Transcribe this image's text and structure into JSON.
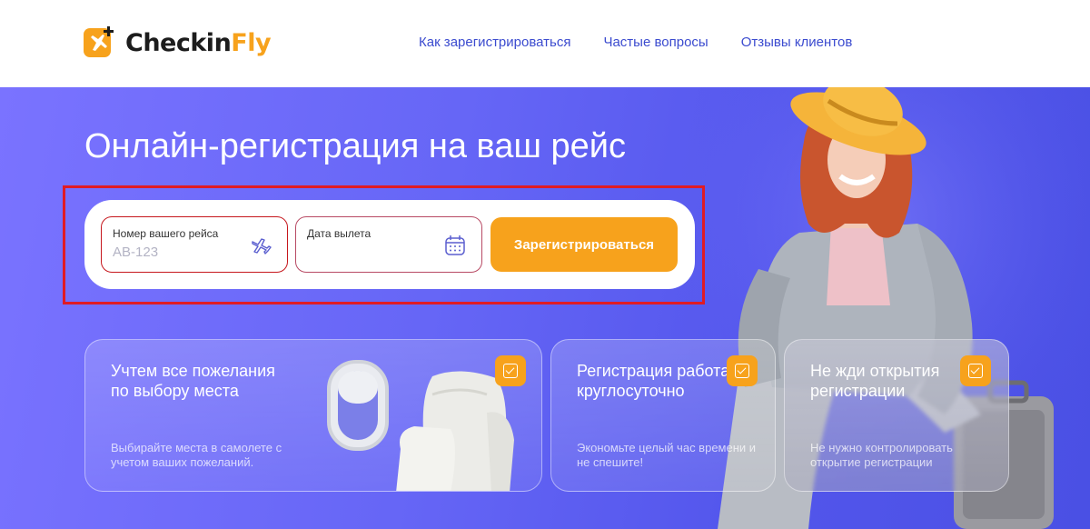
{
  "brand": {
    "name_part1": "Checkin",
    "name_part2": "Fly",
    "accent": "#f7a21c"
  },
  "nav": [
    {
      "label": "Как зарегистрироваться"
    },
    {
      "label": "Частые вопросы"
    },
    {
      "label": "Отзывы клиентов"
    }
  ],
  "hero": {
    "title": "Онлайн-регистрация на ваш рейс"
  },
  "form": {
    "flight_label": "Номер вашего рейса",
    "flight_placeholder": "AB-123",
    "flight_icon": "airplane-icon",
    "date_label": "Дата вылета",
    "date_placeholder": "",
    "date_icon": "calendar-icon",
    "submit_label": "Зарегистрироваться"
  },
  "cards": [
    {
      "title": "Учтем все пожелания по выбору места",
      "desc": "Выбирайте места в самолете с учетом ваших пожеланий."
    },
    {
      "title": "Регистрация работает круглосуточно",
      "desc": "Экономьте целый час времени и не спешите!"
    },
    {
      "title": "Не жди открытия регистрации",
      "desc": "Не нужно контролировать открытие регистрации"
    }
  ],
  "colors": {
    "hero_bg": "#6262f3",
    "button": "#f7a21c",
    "highlight": "#e01b24",
    "nav_link": "#3b4bcf"
  }
}
